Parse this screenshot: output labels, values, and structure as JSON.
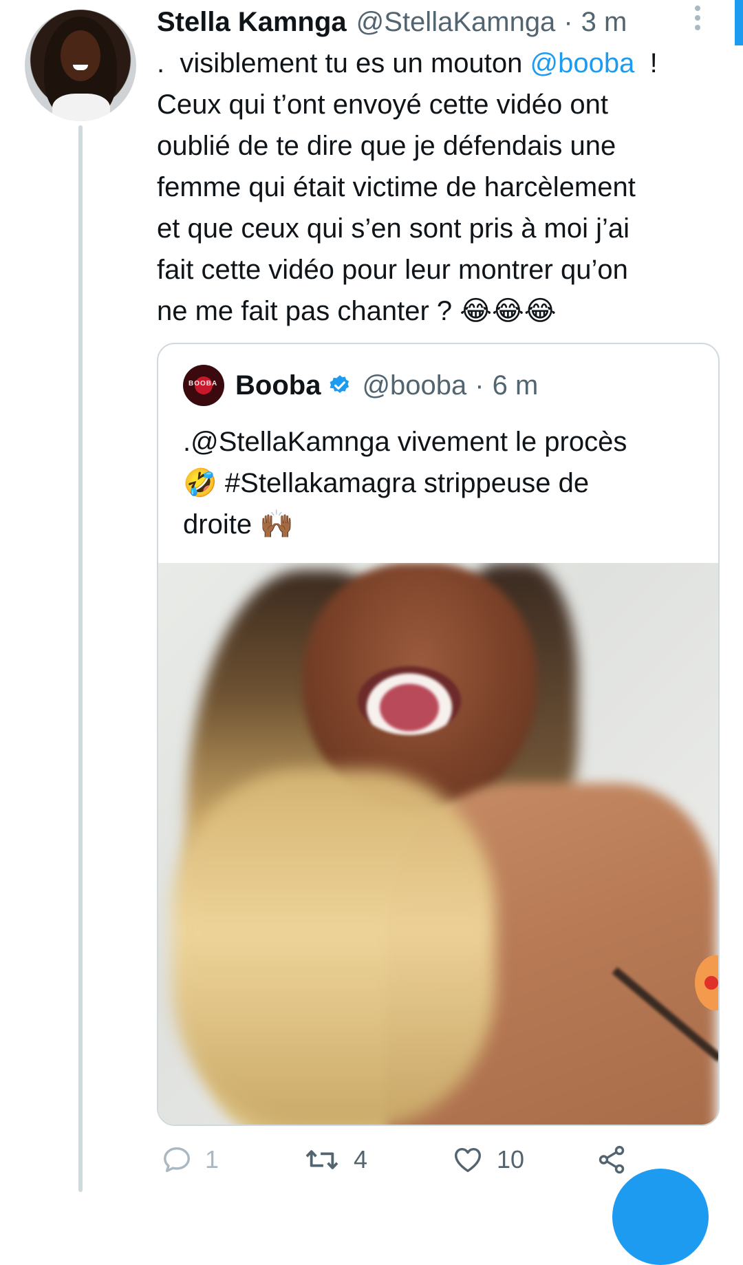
{
  "tweet": {
    "author_name": "Stella Kamnga",
    "author_handle": "@StellaKamnga",
    "separator": "·",
    "time": "3 m",
    "text_before_mention": ".  visiblement tu es un mouton ",
    "mention": "@booba",
    "text_after_mention": "  !\nCeux qui t’ont envoyé cette vidéo ont\noublié de te dire que je défendais une\nfemme qui était victime de harcèlement\net que ceux qui s’en sont pris à moi j’ai\nfait cette vidéo pour leur montrer qu’on\nne me fait pas chanter ? 😂😂😂"
  },
  "quoted_tweet": {
    "author_name": "Booba",
    "author_handle": "@booba",
    "separator": "·",
    "time": "6 m",
    "avatar_text": "BOOBA",
    "text": ".@StellaKamnga vivement le procès\n🤣 #Stellakamagra strippeuse de\ndroite 🙌🏾"
  },
  "actions": {
    "reply_count": "1",
    "retweet_count": "4",
    "like_count": "10"
  },
  "icons": {
    "reply": "speech-bubble-icon",
    "retweet": "retweet-arrows-icon",
    "like": "heart-icon",
    "share": "share-nodes-icon",
    "more": "vertical-dots-icon",
    "verified": "verified-badge-icon"
  },
  "colors": {
    "accent": "#1d9bf0",
    "secondary_text": "#536471",
    "border": "#cfd9de"
  }
}
